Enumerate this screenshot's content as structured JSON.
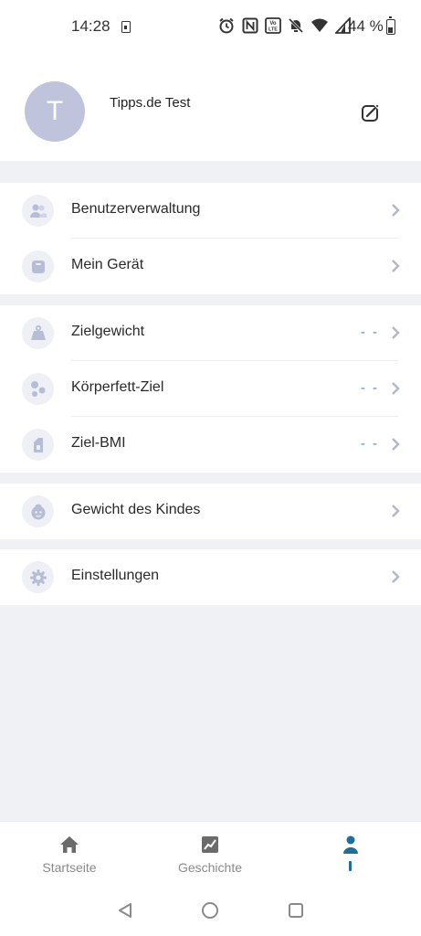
{
  "status_bar": {
    "time": "14:28",
    "battery_text": "44 %",
    "icons": [
      "sim-icon",
      "alarm-icon",
      "nfc-icon",
      "volte-icon",
      "mute-icon",
      "wifi-icon",
      "signal-icon",
      "battery-icon"
    ]
  },
  "profile": {
    "avatar_letter": "T",
    "name": "Tipps.de Test"
  },
  "groups": [
    {
      "items": [
        {
          "label": "Benutzerverwaltung",
          "icon": "users-icon"
        },
        {
          "label": "Mein Gerät",
          "icon": "scale-device-icon"
        }
      ]
    },
    {
      "items": [
        {
          "label": "Zielgewicht",
          "icon": "weight-icon",
          "value": "- -"
        },
        {
          "label": "Körperfett-Ziel",
          "icon": "bodyfat-icon",
          "value": "- -"
        },
        {
          "label": "Ziel-BMI",
          "icon": "bmi-icon",
          "value": "- -"
        }
      ]
    },
    {
      "items": [
        {
          "label": "Gewicht des Kindes",
          "icon": "baby-icon"
        }
      ]
    },
    {
      "items": [
        {
          "label": "Einstellungen",
          "icon": "gear-icon"
        }
      ]
    }
  ],
  "bottom_nav": {
    "items": [
      {
        "label": "Startseite",
        "icon": "home-icon",
        "active": false
      },
      {
        "label": "Geschichte",
        "icon": "chart-icon",
        "active": false
      },
      {
        "label": "",
        "icon": "person-icon",
        "active": true
      }
    ]
  },
  "colors": {
    "avatar_bg": "#bfc3dc",
    "icon_color": "#b8bdd6",
    "accent": "#1f6f99",
    "value_color": "#5a8ab5",
    "background": "#f0f1f5"
  }
}
